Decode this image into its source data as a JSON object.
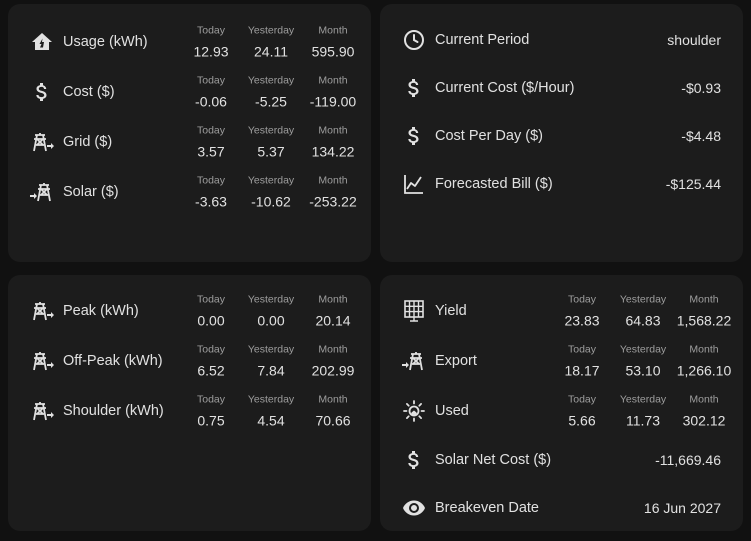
{
  "headers": {
    "today": "Today",
    "yesterday": "Yesterday",
    "month": "Month"
  },
  "energy": {
    "usage": {
      "label": "Usage (kWh)",
      "icon": "home-lightning-icon",
      "today": "12.93",
      "yesterday": "24.11",
      "month": "595.90"
    },
    "cost": {
      "label": "Cost ($)",
      "icon": "dollar-icon",
      "today": "-0.06",
      "yesterday": "-5.25",
      "month": "-119.00"
    },
    "grid": {
      "label": "Grid ($)",
      "icon": "transmission-tower-import-icon",
      "today": "3.57",
      "yesterday": "5.37",
      "month": "134.22"
    },
    "solar": {
      "label": "Solar ($)",
      "icon": "transmission-tower-export-icon",
      "today": "-3.63",
      "yesterday": "-10.62",
      "month": "-253.22"
    }
  },
  "billing": {
    "current_period": {
      "label": "Current Period",
      "icon": "clock-icon",
      "value": "shoulder"
    },
    "current_cost": {
      "label": "Current Cost ($/Hour)",
      "icon": "dollar-icon",
      "value": "-$0.93"
    },
    "cost_per_day": {
      "label": "Cost Per Day ($)",
      "icon": "dollar-icon",
      "value": "-$4.48"
    },
    "forecasted_bill": {
      "label": "Forecasted Bill ($)",
      "icon": "chart-line-icon",
      "value": "-$125.44"
    }
  },
  "tariff": {
    "peak": {
      "label": "Peak (kWh)",
      "icon": "transmission-tower-import-icon",
      "today": "0.00",
      "yesterday": "0.00",
      "month": "20.14"
    },
    "offpeak": {
      "label": "Off-Peak (kWh)",
      "icon": "transmission-tower-import-icon",
      "today": "6.52",
      "yesterday": "7.84",
      "month": "202.99"
    },
    "shoulder": {
      "label": "Shoulder (kWh)",
      "icon": "transmission-tower-import-icon",
      "today": "0.75",
      "yesterday": "4.54",
      "month": "70.66"
    }
  },
  "solar": {
    "yield": {
      "label": "Yield",
      "icon": "solar-panel-icon",
      "today": "23.83",
      "yesterday": "64.83",
      "month": "1,568.22"
    },
    "export": {
      "label": "Export",
      "icon": "transmission-tower-export-icon",
      "today": "18.17",
      "yesterday": "53.10",
      "month": "1,266.10"
    },
    "used": {
      "label": "Used",
      "icon": "sun-house-icon",
      "today": "5.66",
      "yesterday": "11.73",
      "month": "302.12"
    },
    "net_cost": {
      "label": "Solar Net Cost ($)",
      "icon": "dollar-icon",
      "value": "-11,669.46"
    },
    "breakeven": {
      "label": "Breakeven Date",
      "icon": "eye-icon",
      "value": "16 Jun 2027"
    }
  }
}
